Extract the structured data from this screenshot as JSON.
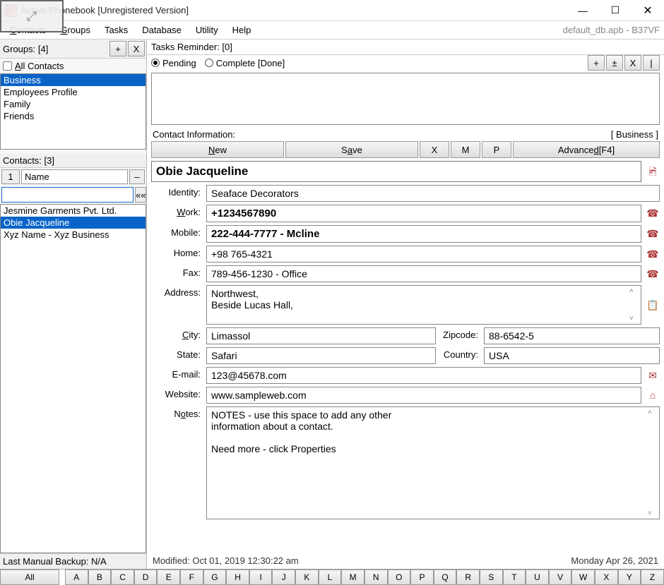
{
  "window": {
    "title": "Active Phonebook [Unregistered Version]",
    "db_file": "default_db.apb - B37VF"
  },
  "menu": {
    "contacts": "Contacts",
    "groups": "Groups",
    "tasks": "Tasks",
    "database": "Database",
    "utility": "Utility",
    "help": "Help"
  },
  "groups": {
    "header": "Groups: [4]",
    "all_label": "All Contacts",
    "btn_add": "+",
    "btn_del": "X",
    "items": [
      "Business",
      "Employees Profile",
      "Family",
      "Friends"
    ],
    "selected_index": 0
  },
  "contacts": {
    "header": "Contacts: [3]",
    "name_id_label": "1",
    "name_label": "Name",
    "dash": "–",
    "search_go": "««",
    "items": [
      "Jesmine Garments Pvt. Ltd.",
      "Obie Jacqueline",
      "Xyz Name - Xyz Business"
    ],
    "selected_index": 1
  },
  "tasks": {
    "header": "Tasks Reminder: [0]",
    "pending": "Pending",
    "complete": "Complete [Done]",
    "btn_add": "+",
    "btn_pm": "±",
    "btn_del": "X",
    "btn_bar": "|"
  },
  "ci": {
    "header": "Contact Information:",
    "group_tag": "[ Business ]",
    "btn_new": "New",
    "btn_save": "Save",
    "btn_x": "X",
    "btn_m": "M",
    "btn_p": "P",
    "btn_adv": "Advanced [F4]"
  },
  "contact": {
    "full_name": "Obie Jacqueline",
    "identity_label": "Identity:",
    "identity": "Seaface Decorators",
    "work_label": "Work:",
    "work": "+1234567890",
    "mobile_label": "Mobile:",
    "mobile": "222-444-7777 - Mcline",
    "home_label": "Home:",
    "home": "+98 765-4321",
    "fax_label": "Fax:",
    "fax": "789-456-1230 - Office",
    "address_label": "Address:",
    "address": "Northwest,\nBeside Lucas Hall,",
    "city_label": "City:",
    "city": "Limassol",
    "zip_label": "Zipcode:",
    "zip": "88-6542-5",
    "state_label": "State:",
    "state": "Safari",
    "country_label": "Country:",
    "country": "USA",
    "email_label": "E-mail:",
    "email": "123@45678.com",
    "website_label": "Website:",
    "website": "www.sampleweb.com",
    "notes_label": "Notes:",
    "notes": "NOTES - use this space to add any other\ninformation about a contact.\n\nNeed more - click Properties"
  },
  "footer": {
    "modified_label": "Modified:",
    "modified_value": "Oct 01, 2019 12:30:22 am",
    "backup": "Last Manual Backup: N/A",
    "today": "Monday Apr 26, 2021"
  },
  "alpha": {
    "all": "All",
    "letters": [
      "A",
      "B",
      "C",
      "D",
      "E",
      "F",
      "G",
      "H",
      "I",
      "J",
      "K",
      "L",
      "M",
      "N",
      "O",
      "P",
      "Q",
      "R",
      "S",
      "T",
      "U",
      "V",
      "W",
      "X",
      "Y",
      "Z"
    ]
  },
  "icons": {
    "phone": "☎",
    "clipboard": "📋",
    "mail": "✉",
    "home": "⌂",
    "photo": "🖻"
  }
}
